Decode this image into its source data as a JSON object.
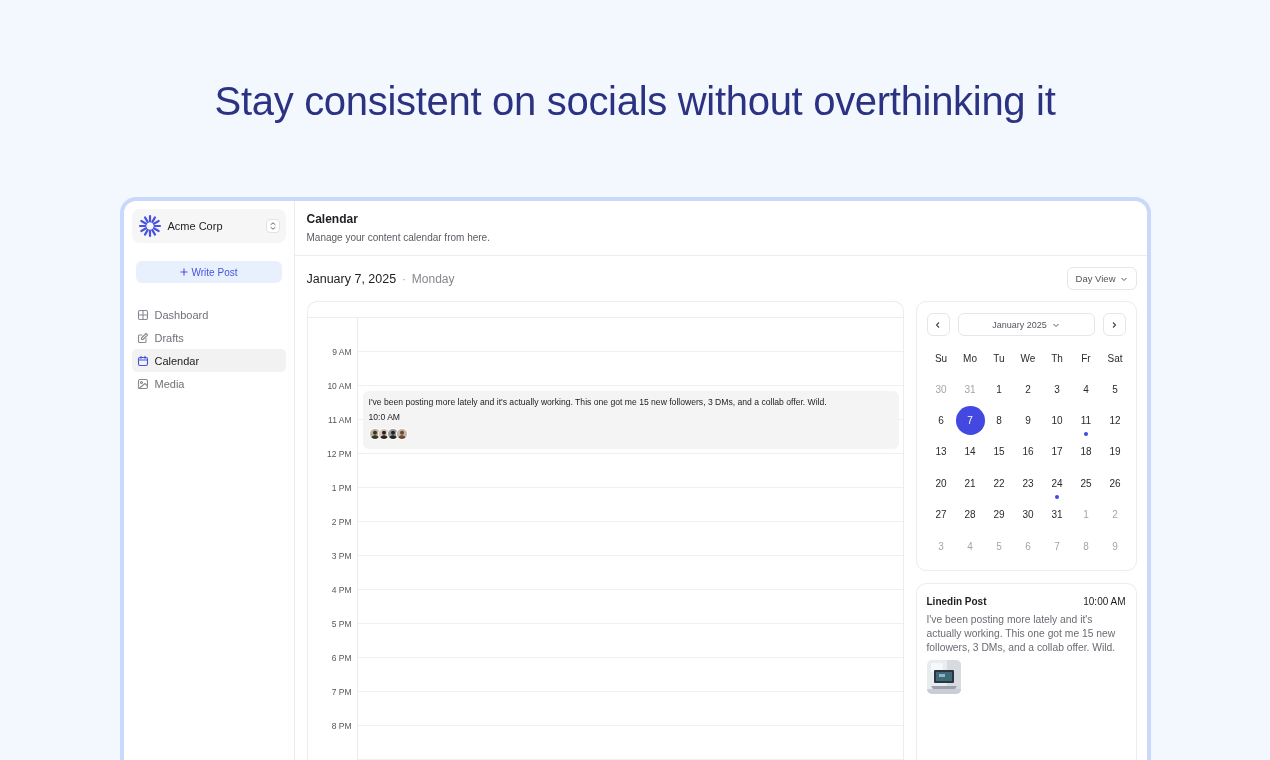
{
  "headline": "Stay consistent on socials without overthinking it",
  "sidebar": {
    "workspace": "Acme Corp",
    "write_button": "Write Post",
    "items": [
      {
        "label": "Dashboard",
        "selected": false
      },
      {
        "label": "Drafts",
        "selected": false
      },
      {
        "label": "Calendar",
        "selected": true
      },
      {
        "label": "Media",
        "selected": false
      }
    ]
  },
  "header": {
    "title": "Calendar",
    "subtitle": "Manage your content calendar from here."
  },
  "toolbar": {
    "date": "January 7, 2025",
    "separator": "·",
    "weekday": "Monday",
    "view_select": "Day View"
  },
  "day_grid": {
    "hours": [
      "9 AM",
      "10 AM",
      "11 AM",
      "12 PM",
      "1 PM",
      "2 PM",
      "3 PM",
      "4 PM",
      "5 PM",
      "6 PM",
      "7 PM",
      "8 PM"
    ],
    "event": {
      "text": "I've been posting more lately and it's actually working. This one got me 15 new followers, 3 DMs, and a collab offer. Wild.",
      "time": "10:0 AM"
    }
  },
  "mini_calendar": {
    "month": "January 2025",
    "weekdays": [
      "Su",
      "Mo",
      "Tu",
      "We",
      "Th",
      "Fr",
      "Sat"
    ],
    "days": [
      {
        "label": "30",
        "muted": true,
        "selected": false,
        "marked": false
      },
      {
        "label": "31",
        "muted": true,
        "selected": false,
        "marked": false
      },
      {
        "label": "1",
        "muted": false,
        "selected": false,
        "marked": false
      },
      {
        "label": "2",
        "muted": false,
        "selected": false,
        "marked": false
      },
      {
        "label": "3",
        "muted": false,
        "selected": false,
        "marked": false
      },
      {
        "label": "4",
        "muted": false,
        "selected": false,
        "marked": false
      },
      {
        "label": "5",
        "muted": false,
        "selected": false,
        "marked": false
      },
      {
        "label": "6",
        "muted": false,
        "selected": false,
        "marked": false
      },
      {
        "label": "7",
        "muted": false,
        "selected": true,
        "marked": false
      },
      {
        "label": "8",
        "muted": false,
        "selected": false,
        "marked": false
      },
      {
        "label": "9",
        "muted": false,
        "selected": false,
        "marked": false
      },
      {
        "label": "10",
        "muted": false,
        "selected": false,
        "marked": false
      },
      {
        "label": "11",
        "muted": false,
        "selected": false,
        "marked": true
      },
      {
        "label": "12",
        "muted": false,
        "selected": false,
        "marked": false
      },
      {
        "label": "13",
        "muted": false,
        "selected": false,
        "marked": false
      },
      {
        "label": "14",
        "muted": false,
        "selected": false,
        "marked": false
      },
      {
        "label": "15",
        "muted": false,
        "selected": false,
        "marked": false
      },
      {
        "label": "16",
        "muted": false,
        "selected": false,
        "marked": false
      },
      {
        "label": "17",
        "muted": false,
        "selected": false,
        "marked": false
      },
      {
        "label": "18",
        "muted": false,
        "selected": false,
        "marked": false
      },
      {
        "label": "19",
        "muted": false,
        "selected": false,
        "marked": false
      },
      {
        "label": "20",
        "muted": false,
        "selected": false,
        "marked": false
      },
      {
        "label": "21",
        "muted": false,
        "selected": false,
        "marked": false
      },
      {
        "label": "22",
        "muted": false,
        "selected": false,
        "marked": false
      },
      {
        "label": "23",
        "muted": false,
        "selected": false,
        "marked": false
      },
      {
        "label": "24",
        "muted": false,
        "selected": false,
        "marked": true
      },
      {
        "label": "25",
        "muted": false,
        "selected": false,
        "marked": false
      },
      {
        "label": "26",
        "muted": false,
        "selected": false,
        "marked": false
      },
      {
        "label": "27",
        "muted": false,
        "selected": false,
        "marked": false
      },
      {
        "label": "28",
        "muted": false,
        "selected": false,
        "marked": false
      },
      {
        "label": "29",
        "muted": false,
        "selected": false,
        "marked": false
      },
      {
        "label": "30",
        "muted": false,
        "selected": false,
        "marked": false
      },
      {
        "label": "31",
        "muted": false,
        "selected": false,
        "marked": false
      },
      {
        "label": "1",
        "muted": true,
        "selected": false,
        "marked": false
      },
      {
        "label": "2",
        "muted": true,
        "selected": false,
        "marked": false
      },
      {
        "label": "3",
        "muted": true,
        "selected": false,
        "marked": false
      },
      {
        "label": "4",
        "muted": true,
        "selected": false,
        "marked": false
      },
      {
        "label": "5",
        "muted": true,
        "selected": false,
        "marked": false
      },
      {
        "label": "6",
        "muted": true,
        "selected": false,
        "marked": false
      },
      {
        "label": "7",
        "muted": true,
        "selected": false,
        "marked": false
      },
      {
        "label": "8",
        "muted": true,
        "selected": false,
        "marked": false
      },
      {
        "label": "9",
        "muted": true,
        "selected": false,
        "marked": false
      }
    ]
  },
  "post_card": {
    "title": "Linedin Post",
    "time": "10:00 AM",
    "body": "I've been posting more lately and it's actually working. This one got me 15 new followers, 3 DMs, and a collab offer. Wild."
  }
}
